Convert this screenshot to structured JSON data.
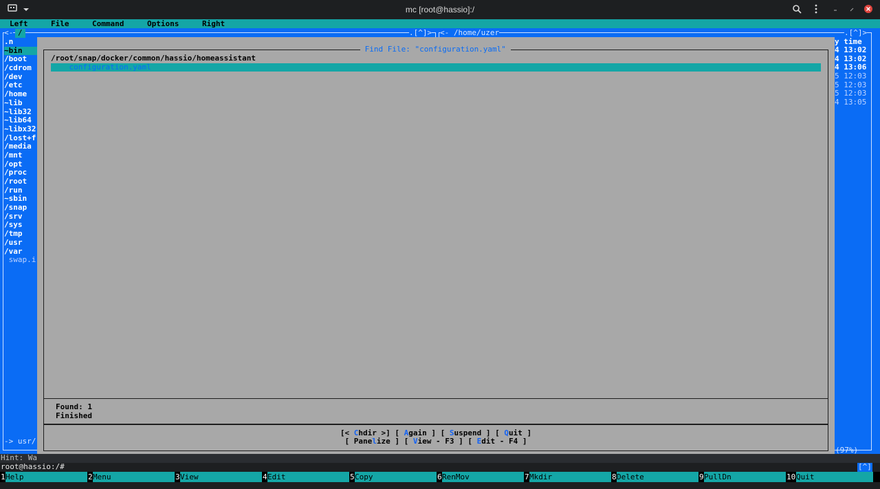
{
  "window": {
    "title": "mc [root@hassio]:/",
    "icons": [
      "terminal-icon",
      "dropdown-icon",
      "search-icon",
      "kebab-menu-icon",
      "minimize-icon",
      "maximize-icon",
      "close-icon"
    ],
    "close_color": "#e0443e"
  },
  "menubar": {
    "items": [
      "Left",
      "File",
      "Command",
      "Options",
      "Right"
    ]
  },
  "left_panel": {
    "path_label": "/",
    "header_left": "<-",
    "header_right": ".[^]>",
    "entries": [
      ".n",
      "~bin",
      "/boot",
      "/cdrom",
      "/dev",
      "/etc",
      "/home",
      "~lib",
      "~lib32",
      "~lib64",
      "~libx32",
      "/lost+f",
      "/media",
      "/mnt",
      "/opt",
      "/proc",
      "/root",
      "/run",
      "~sbin",
      "/snap",
      "/srv",
      "/sys",
      "/tmp",
      "/usr",
      "/var",
      " swap.i"
    ],
    "selected_index": 1,
    "footer": "-> usr/"
  },
  "right_panel": {
    "path_label": "<- /home/uzer",
    "header_right": ".[^]>",
    "column_header": "y time",
    "rows": [
      "4 13:02",
      "4 13:02",
      "4 13:06",
      "5 12:03",
      "5 12:03",
      "5 12:03",
      "4 13:05"
    ],
    "bold_rows": 3,
    "footer": "(97%)"
  },
  "dialog": {
    "title": " Find File: \"configuration.yaml\" ",
    "result_dir": "/root/snap/docker/common/hassio/homeassistant",
    "result_file": "    configuration.yaml",
    "found": "Found: 1",
    "status": "Finished",
    "buttons_row1": [
      {
        "pre": "[< ",
        "hot": "C",
        "post": "hdir >]"
      },
      {
        "pre": "[ ",
        "hot": "A",
        "post": "gain ]"
      },
      {
        "pre": "[ ",
        "hot": "S",
        "post": "uspend ]"
      },
      {
        "pre": "[ ",
        "hot": "Q",
        "post": "uit ]"
      }
    ],
    "buttons_row2": [
      {
        "pre": "[ Pane",
        "hot": "l",
        "post": "ize ]"
      },
      {
        "pre": "[ ",
        "hot": "V",
        "post": "iew - F3 ]"
      },
      {
        "pre": "[ ",
        "hot": "E",
        "post": "dit - F4 ]"
      }
    ]
  },
  "hint": "Hint: Wa",
  "command_prompt": "root@hassio:/#",
  "corner_indicator": "[^]",
  "fkeys": [
    {
      "num": "1",
      "label": "Help"
    },
    {
      "num": "2",
      "label": "Menu"
    },
    {
      "num": "3",
      "label": "View"
    },
    {
      "num": "4",
      "label": "Edit"
    },
    {
      "num": "5",
      "label": "Copy"
    },
    {
      "num": "6",
      "label": "RenMov"
    },
    {
      "num": "7",
      "label": "Mkdir"
    },
    {
      "num": "8",
      "label": "Delete"
    },
    {
      "num": "9",
      "label": "PullDn"
    },
    {
      "num": "10",
      "label": "Quit"
    }
  ],
  "colors": {
    "panel_bg": "#0a6cf5",
    "menubar_bg": "#14a6a6",
    "dialog_bg": "#a8a8a8",
    "selection_bg": "#14a6a6"
  }
}
